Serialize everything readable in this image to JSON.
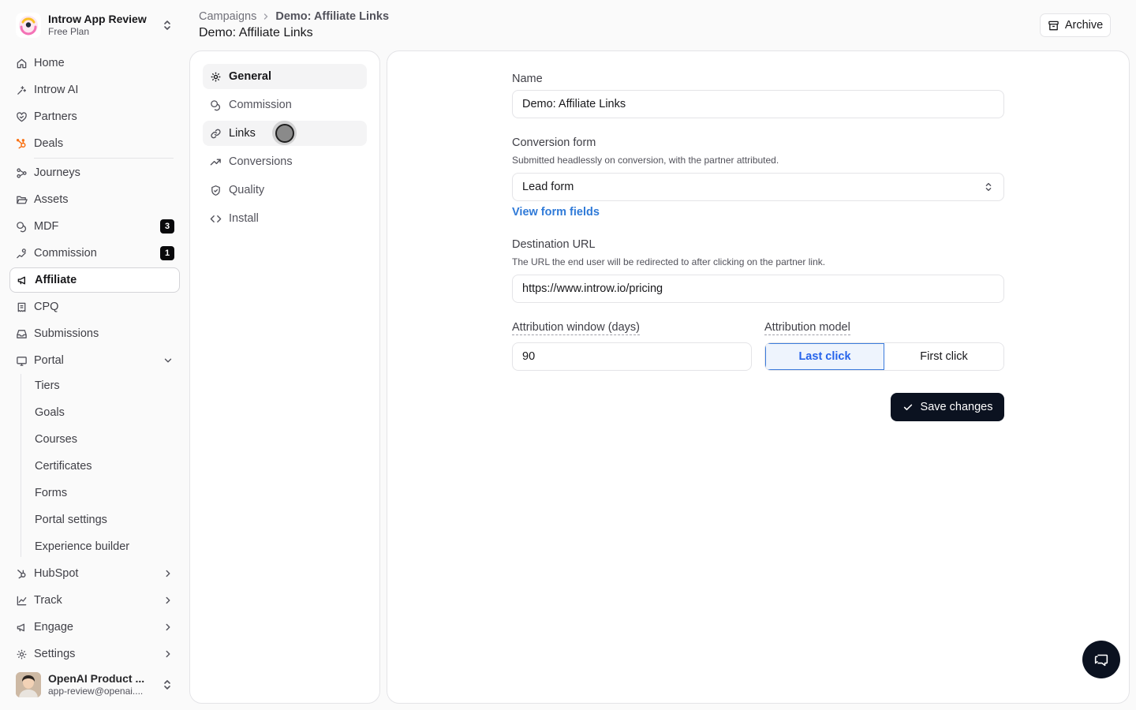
{
  "workspace": {
    "name": "Introw App Review",
    "plan": "Free Plan"
  },
  "sidebar": {
    "items": [
      {
        "label": "Home"
      },
      {
        "label": "Introw AI"
      },
      {
        "label": "Partners"
      },
      {
        "label": "Deals"
      },
      {
        "label": "Journeys"
      },
      {
        "label": "Assets"
      },
      {
        "label": "MDF",
        "badge": "3"
      },
      {
        "label": "Commission",
        "badge": "1"
      },
      {
        "label": "Affiliate"
      },
      {
        "label": "CPQ"
      },
      {
        "label": "Submissions"
      },
      {
        "label": "Portal"
      }
    ],
    "portal_sub": [
      "Tiers",
      "Goals",
      "Courses",
      "Certificates",
      "Forms",
      "Portal settings",
      "Experience builder"
    ],
    "groups": [
      "HubSpot",
      "Track",
      "Engage",
      "Settings"
    ],
    "active": "Affiliate"
  },
  "user": {
    "name": "OpenAI Product ...",
    "email": "app-review@openai...."
  },
  "header": {
    "breadcrumb_root": "Campaigns",
    "breadcrumb_current": "Demo: Affiliate Links",
    "title": "Demo: Affiliate Links",
    "archive_label": "Archive"
  },
  "menu": {
    "items": [
      "General",
      "Commission",
      "Links",
      "Conversions",
      "Quality",
      "Install"
    ],
    "active": "General",
    "hover": "Links"
  },
  "form": {
    "name_label": "Name",
    "name_value": "Demo: Affiliate Links",
    "conversion_label": "Conversion form",
    "conversion_help": "Submitted headlessly on conversion, with the partner attributed.",
    "conversion_value": "Lead form",
    "view_fields_link": "View form fields",
    "destination_label": "Destination URL",
    "destination_help": "The URL the end user will be redirected to after clicking on the partner link.",
    "destination_value": "https://www.introw.io/pricing",
    "window_label": "Attribution window (days)",
    "window_value": "90",
    "model_label": "Attribution model",
    "model_options": [
      "Last click",
      "First click"
    ],
    "model_selected": "Last click",
    "save_label": "Save changes"
  },
  "colors": {
    "accent": "#2563eb",
    "dark": "#0b1220",
    "badge": "#09090b",
    "deals_icon": "#f97316"
  }
}
